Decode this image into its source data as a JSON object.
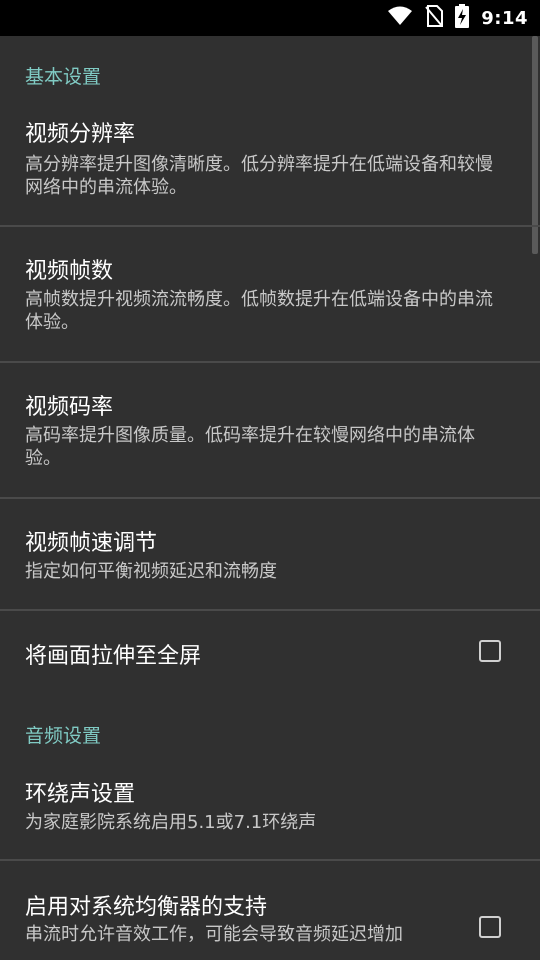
{
  "status_bar": {
    "time": "9:14",
    "icons": [
      "wifi-icon",
      "no-sim-icon",
      "battery-charging-icon"
    ]
  },
  "basic_settings": {
    "header": "基本设置",
    "resolution": {
      "title": "视频分辨率",
      "summary": "高分辨率提升图像清晰度。低分辨率提升在低端设备和较慢网络中的串流体验。"
    },
    "fps": {
      "title": "视频帧数",
      "summary": "高帧数提升视频流流畅度。低帧数提升在低端设备中的串流体验。"
    },
    "bitrate": {
      "title": "视频码率",
      "summary": "高码率提升图像质量。低码率提升在较慢网络中的串流体验。"
    },
    "frame_pacing": {
      "title": "视频帧速调节",
      "summary": "指定如何平衡视频延迟和流畅度"
    },
    "stretch": {
      "title": "将画面拉伸至全屏",
      "checked": false
    }
  },
  "audio_settings": {
    "header": "音频设置",
    "surround": {
      "title": "环绕声设置",
      "summary": "为家庭影院系统启用5.1或7.1环绕声"
    },
    "equalizer": {
      "title": "启用对系统均衡器的支持",
      "summary": "串流时允许音效工作，可能会导致音频延迟增加",
      "checked": false
    }
  },
  "colors": {
    "background": "#303030",
    "accent": "#80cbc4",
    "status_bar": "#000000"
  }
}
